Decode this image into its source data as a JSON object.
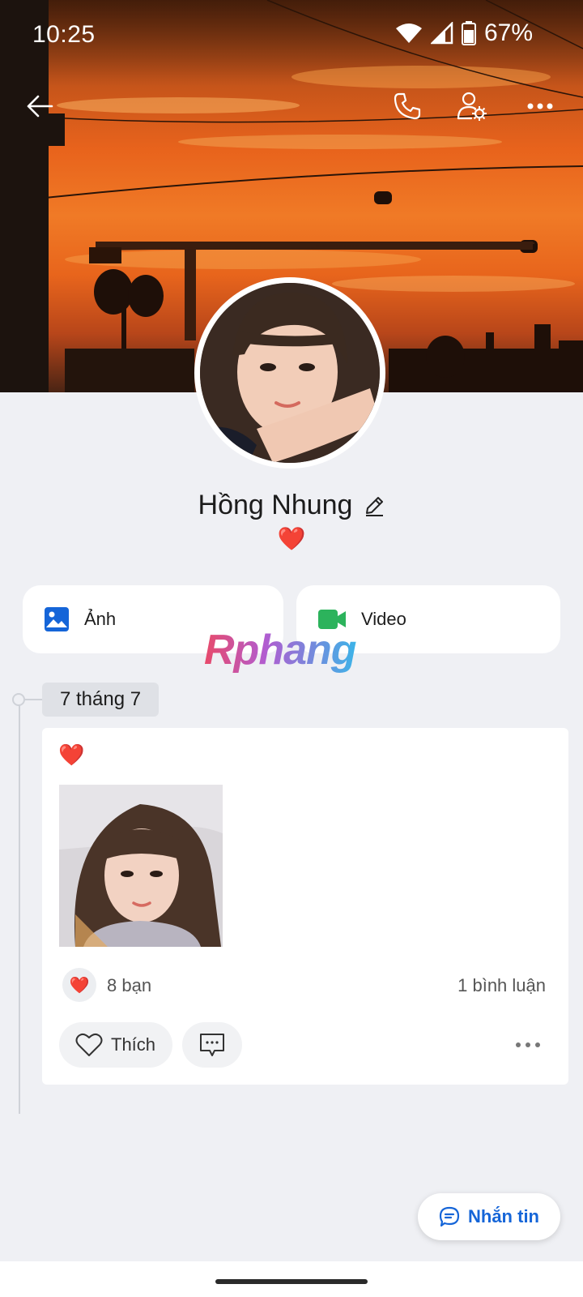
{
  "status_bar": {
    "time": "10:25",
    "battery": "67%"
  },
  "profile": {
    "name": "Hồng Nhung",
    "bio": "❤️"
  },
  "media": {
    "photos_label": "Ảnh",
    "video_label": "Video"
  },
  "watermark": "Rphang",
  "timeline": {
    "date": "7 tháng 7",
    "post": {
      "text": "❤️",
      "reaction_emoji": "❤️",
      "reaction_count": "8 bạn",
      "comment_count": "1 bình luận",
      "like_label": "Thích"
    }
  },
  "message_button": {
    "label": "Nhắn tin"
  },
  "colors": {
    "accent": "#1565d8",
    "photo_icon": "#1565d8",
    "video_icon": "#2cb35c",
    "background": "#eff0f4"
  },
  "icons": {
    "back": "arrow-left-icon",
    "call": "phone-icon",
    "settings": "user-settings-icon",
    "more": "more-horizontal-icon"
  }
}
